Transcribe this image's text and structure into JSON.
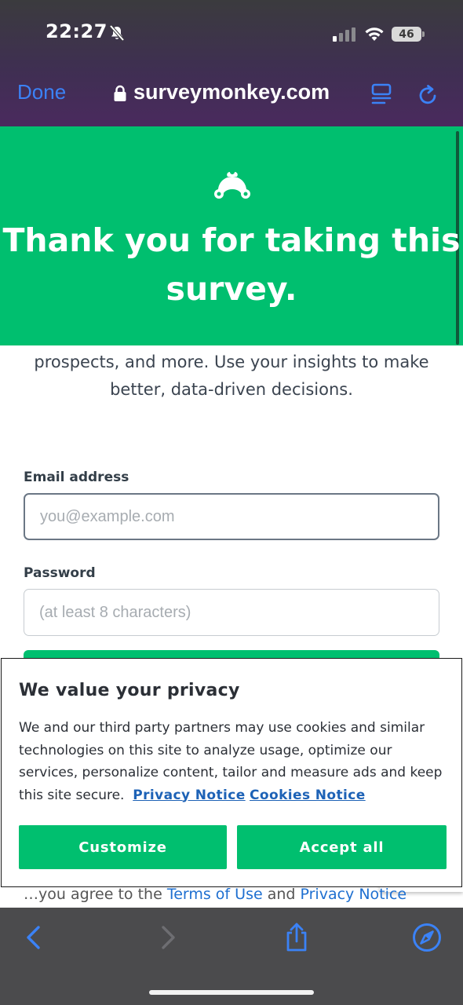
{
  "status_bar": {
    "time": "22:27",
    "battery": "46"
  },
  "browser": {
    "done_label": "Done",
    "url": "surveymonkey.com",
    "accent_color": "#3b82f6"
  },
  "hero": {
    "title": "Thank you for taking this survey.",
    "background_color": "#00bf6f"
  },
  "main": {
    "body_text": "prospects, and more. Use your insights to make better, data-driven decisions.",
    "email": {
      "label": "Email address",
      "placeholder": "you@example.com"
    },
    "password": {
      "label": "Password",
      "placeholder": "(at least 8 characters)"
    },
    "terms_partial": {
      "prefix": "…you agree to the",
      "terms_link": "Terms of Use",
      "and": "and",
      "privacy_link": "Privacy Notice"
    }
  },
  "privacy_modal": {
    "title": "We value your privacy",
    "text": "We and our third party partners may use cookies and similar technologies on this site to analyze usage, optimize our services, personalize content, tailor and measure ads and keep this site secure.",
    "privacy_notice_link": "Privacy Notice",
    "cookies_notice_link": "Cookies Notice",
    "customize_label": "Customize",
    "accept_label": "Accept all"
  },
  "toolbar": {
    "icons": [
      "back-icon",
      "forward-icon",
      "share-icon",
      "compass-icon"
    ]
  }
}
